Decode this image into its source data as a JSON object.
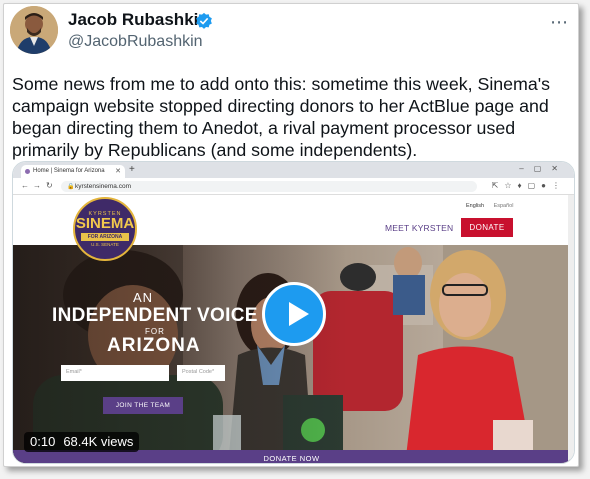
{
  "tweet": {
    "author_name": "Jacob Rubashkin",
    "author_handle": "@JacobRubashkin",
    "verified": true,
    "text": "Some news from me to add onto this: sometime this week, Sinema's campaign website stopped directing donors to her ActBlue page and began directing them to Anedot, a rival payment processor used primarily by Republicans (and some independents).",
    "more_icon": "ellipsis-icon"
  },
  "media": {
    "browser": {
      "tab_title": "Home | Sinema for Arizona",
      "url": "kyrstensinema.com"
    },
    "site": {
      "logo": {
        "top": "KYRSTEN",
        "main": "SINEMA",
        "strip": "FOR ARIZONA",
        "sub": "U.S. SENATE"
      },
      "lang_en": "English",
      "lang_es": "Español",
      "meet_link": "MEET KYRSTEN",
      "donate_button": "DONATE",
      "hero_an": "AN",
      "hero_line1": "INDEPENDENT VOICE",
      "hero_for": "FOR",
      "hero_line2": "ARIZONA",
      "email_placeholder": "Email*",
      "zip_placeholder": "Postal Code*",
      "join_button": "JOIN THE TEAM",
      "donate_bar": "DONATE NOW"
    },
    "video": {
      "time": "0:10",
      "views": "68.4K views"
    }
  },
  "colors": {
    "accent_blue": "#1d9bf0",
    "site_purple": "#5a3f87",
    "site_red": "#c8102e",
    "logo_gold": "#e9c24a"
  }
}
